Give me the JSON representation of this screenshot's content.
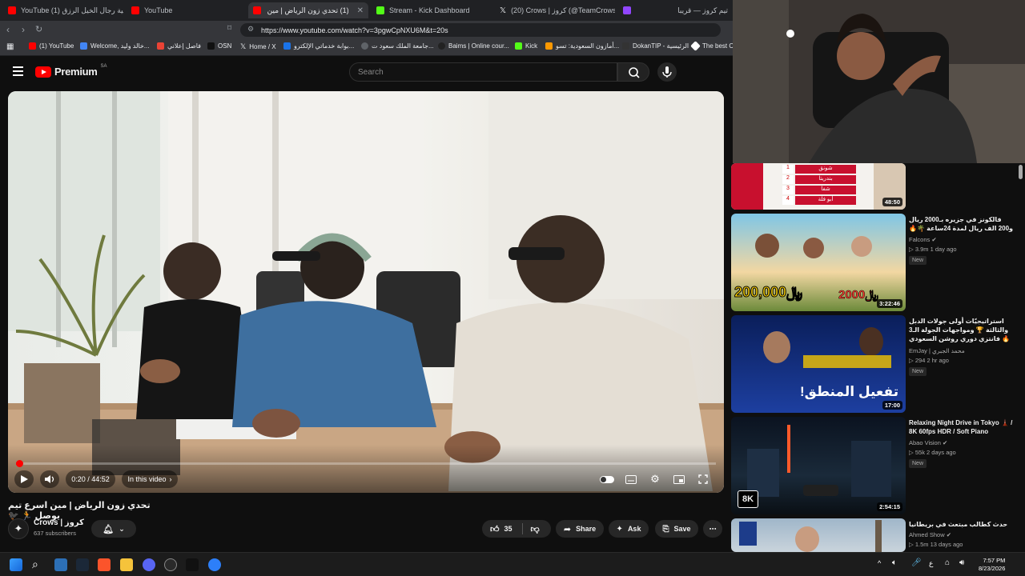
{
  "browser": {
    "tabs": [
      {
        "title": "YouTube (1) اغنية رجال الخيل الرزق",
        "favicon_color": "#ff0000"
      },
      {
        "title": "YouTube",
        "favicon_color": "#ff0000"
      },
      {
        "title": "(1) تحدي زون الرياض | مين اسرع",
        "favicon_color": "#ff0000"
      },
      {
        "title": "Stream - Kick Dashboard",
        "favicon_color": "#53fc18"
      },
      {
        "title": "(20) Crows | كروز (@TeamCrowsSA) /",
        "favicon_color": "#000000"
      },
      {
        "title": "",
        "favicon_color": "#9146ff"
      },
      {
        "title": "تيم كروز — قريبا",
        "favicon_color": "#cc0000"
      }
    ],
    "url": "https://www.youtube.com/watch?v=3pgwCpNXU6M&t=20s",
    "bookmarks": [
      {
        "label": "(1) YouTube",
        "color": "#ff0000"
      },
      {
        "label": "Welcome, خالد وليد...",
        "color": "#4285f4"
      },
      {
        "label": "فاصل إعلاني",
        "color": "#ea4335"
      },
      {
        "label": "OSN",
        "color": "#111111"
      },
      {
        "label": "Home / X",
        "color": "#000000"
      },
      {
        "label": "بوابة خدماتي الإلكترو...",
        "color": "#1a73e8"
      },
      {
        "label": "جامعة الملك سعود ت...",
        "color": "#5f6368"
      },
      {
        "label": "Baims | Online cour...",
        "color": "#222222"
      },
      {
        "label": "Kick",
        "color": "#53fc18"
      },
      {
        "label": "أمازون السعودية: تسو...",
        "color": "#ff9900"
      },
      {
        "label": "DokanTIP - الرئيسية",
        "color": "#333333"
      },
      {
        "label": "The best Ch",
        "color": "#ffffff"
      }
    ]
  },
  "youtube": {
    "logo_text": "Premium",
    "region": "SA",
    "search_placeholder": "Search"
  },
  "player": {
    "time": "0:20 / 44:52",
    "chapter_label": "In this video",
    "progress": 0.0074
  },
  "video": {
    "title": "تحدي زون الرياض | مين اسرع تيم يوصل 🏃 🐦‍⬛",
    "channel": "Crows | كروز",
    "subscribers": "637 subscribers",
    "likes": "35",
    "share_label": "Share",
    "ask_label": "Ask",
    "save_label": "Save"
  },
  "sidebar": [
    {
      "title": "",
      "channel": "",
      "meta": "",
      "duration": "48:50",
      "new": false
    },
    {
      "title": "فالكونز في جزيره بـ2000 ريال و200 الف ريال لمدة 24ساعة 🌴🔥",
      "channel": "Falcons",
      "meta": "3.9m  1 day ago",
      "duration": "3:22:46",
      "new": true,
      "new_label": "New"
    },
    {
      "title": "استراتيجيّات أولى جولات الدبل والثالثة 🏆 ومواجهات الجولة الـ3 🔥 فانتزي دوري روشن السعودي",
      "channel": "EmJay | محمد الجبري",
      "meta": "294  2 hr ago",
      "duration": "17:00",
      "new": true,
      "new_label": "New"
    },
    {
      "title": "Relaxing Night Drive in Tokyo 🗼 / 8K 60fps HDR / Soft Piano",
      "channel": "Abao Vision",
      "meta": "55k  2 days ago",
      "duration": "2:54:15",
      "new": true,
      "new_label": "New"
    },
    {
      "title": "حدث كطالب مبتعث في بريطانيا",
      "channel": "Ahmed Show",
      "meta": "1.5m  13 days ago",
      "duration": "",
      "new": false
    }
  ],
  "thumb_text": {
    "quiz_items": [
      "شونق",
      "بندريتا",
      "شفا",
      "أبو فلة"
    ],
    "quiz_numbers": [
      "1",
      "2",
      "3",
      "4"
    ],
    "price_1": "200,000",
    "price_2": "2000",
    "price_unit": "﷼",
    "fantasy_text": "تفعيل المنطق!",
    "resolution_badge": "8K"
  },
  "taskbar": {
    "time": "7:57 PM",
    "date": "8/23/2026",
    "lang": "ع"
  },
  "colors": {
    "youtube_red": "#ff0000",
    "progress_red": "#ff0000",
    "bg": "#0f0f0f"
  }
}
